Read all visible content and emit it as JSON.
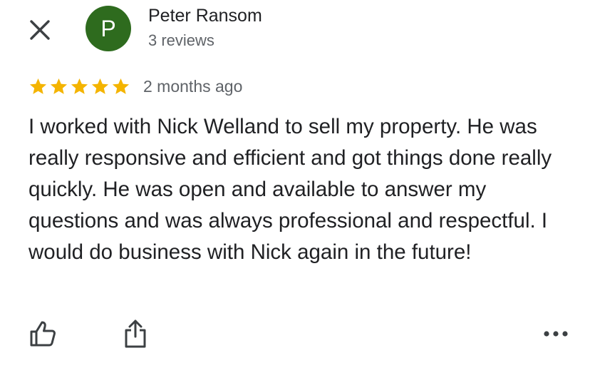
{
  "header": {
    "close_icon": "close-icon",
    "avatar_letter": "P",
    "avatar_color": "#2e6b1e",
    "reviewer_name": "Peter Ransom",
    "review_count": "3 reviews"
  },
  "review": {
    "rating": 5,
    "rating_max": 5,
    "star_color": "#f4b400",
    "date": "2 months ago",
    "text": "I worked with Nick Welland to sell my property. He was really responsive and efficient and got things done really quickly. He was open and available to answer my questions and was always professional and respectful. I would do business with Nick again in the future!"
  },
  "actions": {
    "like_icon": "thumbs-up-icon",
    "share_icon": "share-icon",
    "more_icon": "more-options-icon"
  }
}
